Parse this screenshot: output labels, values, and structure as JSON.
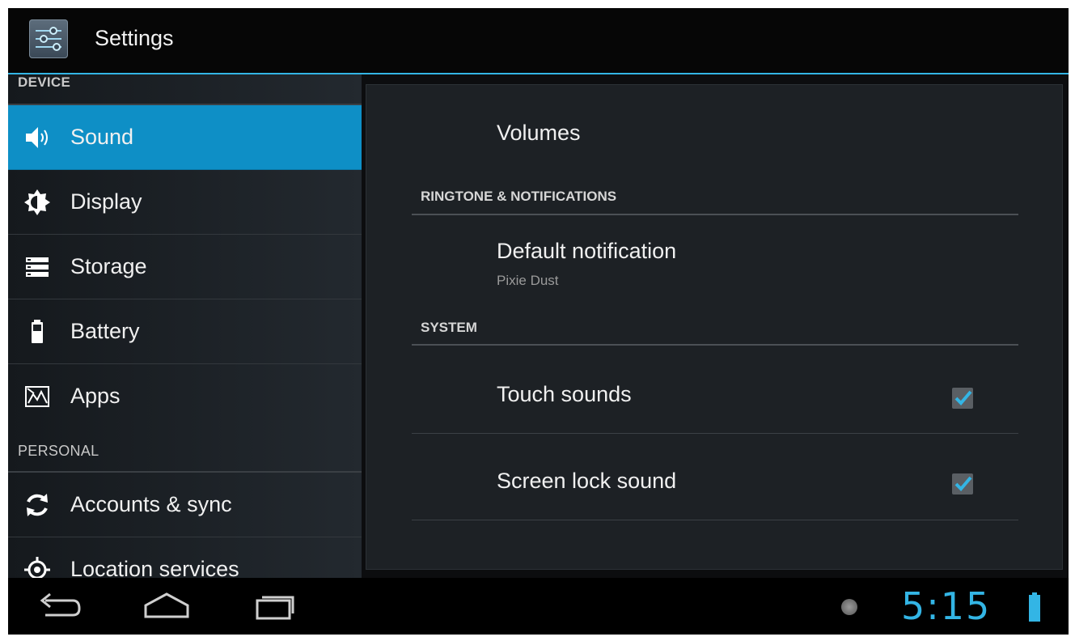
{
  "action_bar": {
    "title": "Settings",
    "app_icon": "settings-sliders-icon"
  },
  "left_pane": {
    "sections": [
      {
        "header": "DEVICE",
        "items": [
          {
            "label": "Sound",
            "icon": "speaker-icon",
            "selected": true
          },
          {
            "label": "Display",
            "icon": "brightness-icon",
            "selected": false
          },
          {
            "label": "Storage",
            "icon": "storage-icon",
            "selected": false
          },
          {
            "label": "Battery",
            "icon": "battery-icon",
            "selected": false
          },
          {
            "label": "Apps",
            "icon": "apps-icon",
            "selected": false
          }
        ]
      },
      {
        "header": "PERSONAL",
        "items": [
          {
            "label": "Accounts & sync",
            "icon": "sync-icon",
            "selected": false
          },
          {
            "label": "Location services",
            "icon": "location-icon",
            "selected": false
          }
        ]
      }
    ]
  },
  "right_pane": {
    "volumes_label": "Volumes",
    "ringtone_header": "RINGTONE & NOTIFICATIONS",
    "default_notification": {
      "title": "Default notification",
      "summary": "Pixie Dust"
    },
    "system_header": "SYSTEM",
    "touch_sounds": {
      "title": "Touch sounds",
      "checked": true
    },
    "screen_lock_sound": {
      "title": "Screen lock sound",
      "checked": true
    }
  },
  "nav_bar": {
    "back": "back-icon",
    "home": "home-icon",
    "recents": "recent-apps-icon",
    "clock": "5:15",
    "accent_color": "#33b5e5"
  }
}
